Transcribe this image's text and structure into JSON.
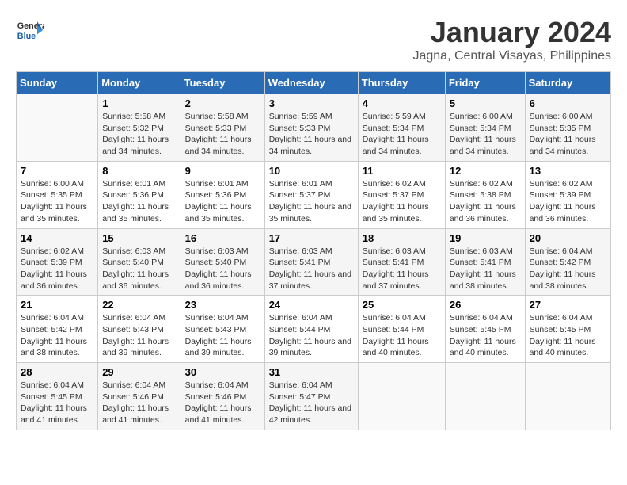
{
  "header": {
    "logo_line1": "General",
    "logo_line2": "Blue",
    "month": "January 2024",
    "location": "Jagna, Central Visayas, Philippines"
  },
  "weekdays": [
    "Sunday",
    "Monday",
    "Tuesday",
    "Wednesday",
    "Thursday",
    "Friday",
    "Saturday"
  ],
  "weeks": [
    [
      {
        "day": "",
        "sunrise": "",
        "sunset": "",
        "daylight": ""
      },
      {
        "day": "1",
        "sunrise": "Sunrise: 5:58 AM",
        "sunset": "Sunset: 5:32 PM",
        "daylight": "Daylight: 11 hours and 34 minutes."
      },
      {
        "day": "2",
        "sunrise": "Sunrise: 5:58 AM",
        "sunset": "Sunset: 5:33 PM",
        "daylight": "Daylight: 11 hours and 34 minutes."
      },
      {
        "day": "3",
        "sunrise": "Sunrise: 5:59 AM",
        "sunset": "Sunset: 5:33 PM",
        "daylight": "Daylight: 11 hours and 34 minutes."
      },
      {
        "day": "4",
        "sunrise": "Sunrise: 5:59 AM",
        "sunset": "Sunset: 5:34 PM",
        "daylight": "Daylight: 11 hours and 34 minutes."
      },
      {
        "day": "5",
        "sunrise": "Sunrise: 6:00 AM",
        "sunset": "Sunset: 5:34 PM",
        "daylight": "Daylight: 11 hours and 34 minutes."
      },
      {
        "day": "6",
        "sunrise": "Sunrise: 6:00 AM",
        "sunset": "Sunset: 5:35 PM",
        "daylight": "Daylight: 11 hours and 34 minutes."
      }
    ],
    [
      {
        "day": "7",
        "sunrise": "Sunrise: 6:00 AM",
        "sunset": "Sunset: 5:35 PM",
        "daylight": "Daylight: 11 hours and 35 minutes."
      },
      {
        "day": "8",
        "sunrise": "Sunrise: 6:01 AM",
        "sunset": "Sunset: 5:36 PM",
        "daylight": "Daylight: 11 hours and 35 minutes."
      },
      {
        "day": "9",
        "sunrise": "Sunrise: 6:01 AM",
        "sunset": "Sunset: 5:36 PM",
        "daylight": "Daylight: 11 hours and 35 minutes."
      },
      {
        "day": "10",
        "sunrise": "Sunrise: 6:01 AM",
        "sunset": "Sunset: 5:37 PM",
        "daylight": "Daylight: 11 hours and 35 minutes."
      },
      {
        "day": "11",
        "sunrise": "Sunrise: 6:02 AM",
        "sunset": "Sunset: 5:37 PM",
        "daylight": "Daylight: 11 hours and 35 minutes."
      },
      {
        "day": "12",
        "sunrise": "Sunrise: 6:02 AM",
        "sunset": "Sunset: 5:38 PM",
        "daylight": "Daylight: 11 hours and 36 minutes."
      },
      {
        "day": "13",
        "sunrise": "Sunrise: 6:02 AM",
        "sunset": "Sunset: 5:39 PM",
        "daylight": "Daylight: 11 hours and 36 minutes."
      }
    ],
    [
      {
        "day": "14",
        "sunrise": "Sunrise: 6:02 AM",
        "sunset": "Sunset: 5:39 PM",
        "daylight": "Daylight: 11 hours and 36 minutes."
      },
      {
        "day": "15",
        "sunrise": "Sunrise: 6:03 AM",
        "sunset": "Sunset: 5:40 PM",
        "daylight": "Daylight: 11 hours and 36 minutes."
      },
      {
        "day": "16",
        "sunrise": "Sunrise: 6:03 AM",
        "sunset": "Sunset: 5:40 PM",
        "daylight": "Daylight: 11 hours and 36 minutes."
      },
      {
        "day": "17",
        "sunrise": "Sunrise: 6:03 AM",
        "sunset": "Sunset: 5:41 PM",
        "daylight": "Daylight: 11 hours and 37 minutes."
      },
      {
        "day": "18",
        "sunrise": "Sunrise: 6:03 AM",
        "sunset": "Sunset: 5:41 PM",
        "daylight": "Daylight: 11 hours and 37 minutes."
      },
      {
        "day": "19",
        "sunrise": "Sunrise: 6:03 AM",
        "sunset": "Sunset: 5:41 PM",
        "daylight": "Daylight: 11 hours and 38 minutes."
      },
      {
        "day": "20",
        "sunrise": "Sunrise: 6:04 AM",
        "sunset": "Sunset: 5:42 PM",
        "daylight": "Daylight: 11 hours and 38 minutes."
      }
    ],
    [
      {
        "day": "21",
        "sunrise": "Sunrise: 6:04 AM",
        "sunset": "Sunset: 5:42 PM",
        "daylight": "Daylight: 11 hours and 38 minutes."
      },
      {
        "day": "22",
        "sunrise": "Sunrise: 6:04 AM",
        "sunset": "Sunset: 5:43 PM",
        "daylight": "Daylight: 11 hours and 39 minutes."
      },
      {
        "day": "23",
        "sunrise": "Sunrise: 6:04 AM",
        "sunset": "Sunset: 5:43 PM",
        "daylight": "Daylight: 11 hours and 39 minutes."
      },
      {
        "day": "24",
        "sunrise": "Sunrise: 6:04 AM",
        "sunset": "Sunset: 5:44 PM",
        "daylight": "Daylight: 11 hours and 39 minutes."
      },
      {
        "day": "25",
        "sunrise": "Sunrise: 6:04 AM",
        "sunset": "Sunset: 5:44 PM",
        "daylight": "Daylight: 11 hours and 40 minutes."
      },
      {
        "day": "26",
        "sunrise": "Sunrise: 6:04 AM",
        "sunset": "Sunset: 5:45 PM",
        "daylight": "Daylight: 11 hours and 40 minutes."
      },
      {
        "day": "27",
        "sunrise": "Sunrise: 6:04 AM",
        "sunset": "Sunset: 5:45 PM",
        "daylight": "Daylight: 11 hours and 40 minutes."
      }
    ],
    [
      {
        "day": "28",
        "sunrise": "Sunrise: 6:04 AM",
        "sunset": "Sunset: 5:45 PM",
        "daylight": "Daylight: 11 hours and 41 minutes."
      },
      {
        "day": "29",
        "sunrise": "Sunrise: 6:04 AM",
        "sunset": "Sunset: 5:46 PM",
        "daylight": "Daylight: 11 hours and 41 minutes."
      },
      {
        "day": "30",
        "sunrise": "Sunrise: 6:04 AM",
        "sunset": "Sunset: 5:46 PM",
        "daylight": "Daylight: 11 hours and 41 minutes."
      },
      {
        "day": "31",
        "sunrise": "Sunrise: 6:04 AM",
        "sunset": "Sunset: 5:47 PM",
        "daylight": "Daylight: 11 hours and 42 minutes."
      },
      {
        "day": "",
        "sunrise": "",
        "sunset": "",
        "daylight": ""
      },
      {
        "day": "",
        "sunrise": "",
        "sunset": "",
        "daylight": ""
      },
      {
        "day": "",
        "sunrise": "",
        "sunset": "",
        "daylight": ""
      }
    ]
  ]
}
